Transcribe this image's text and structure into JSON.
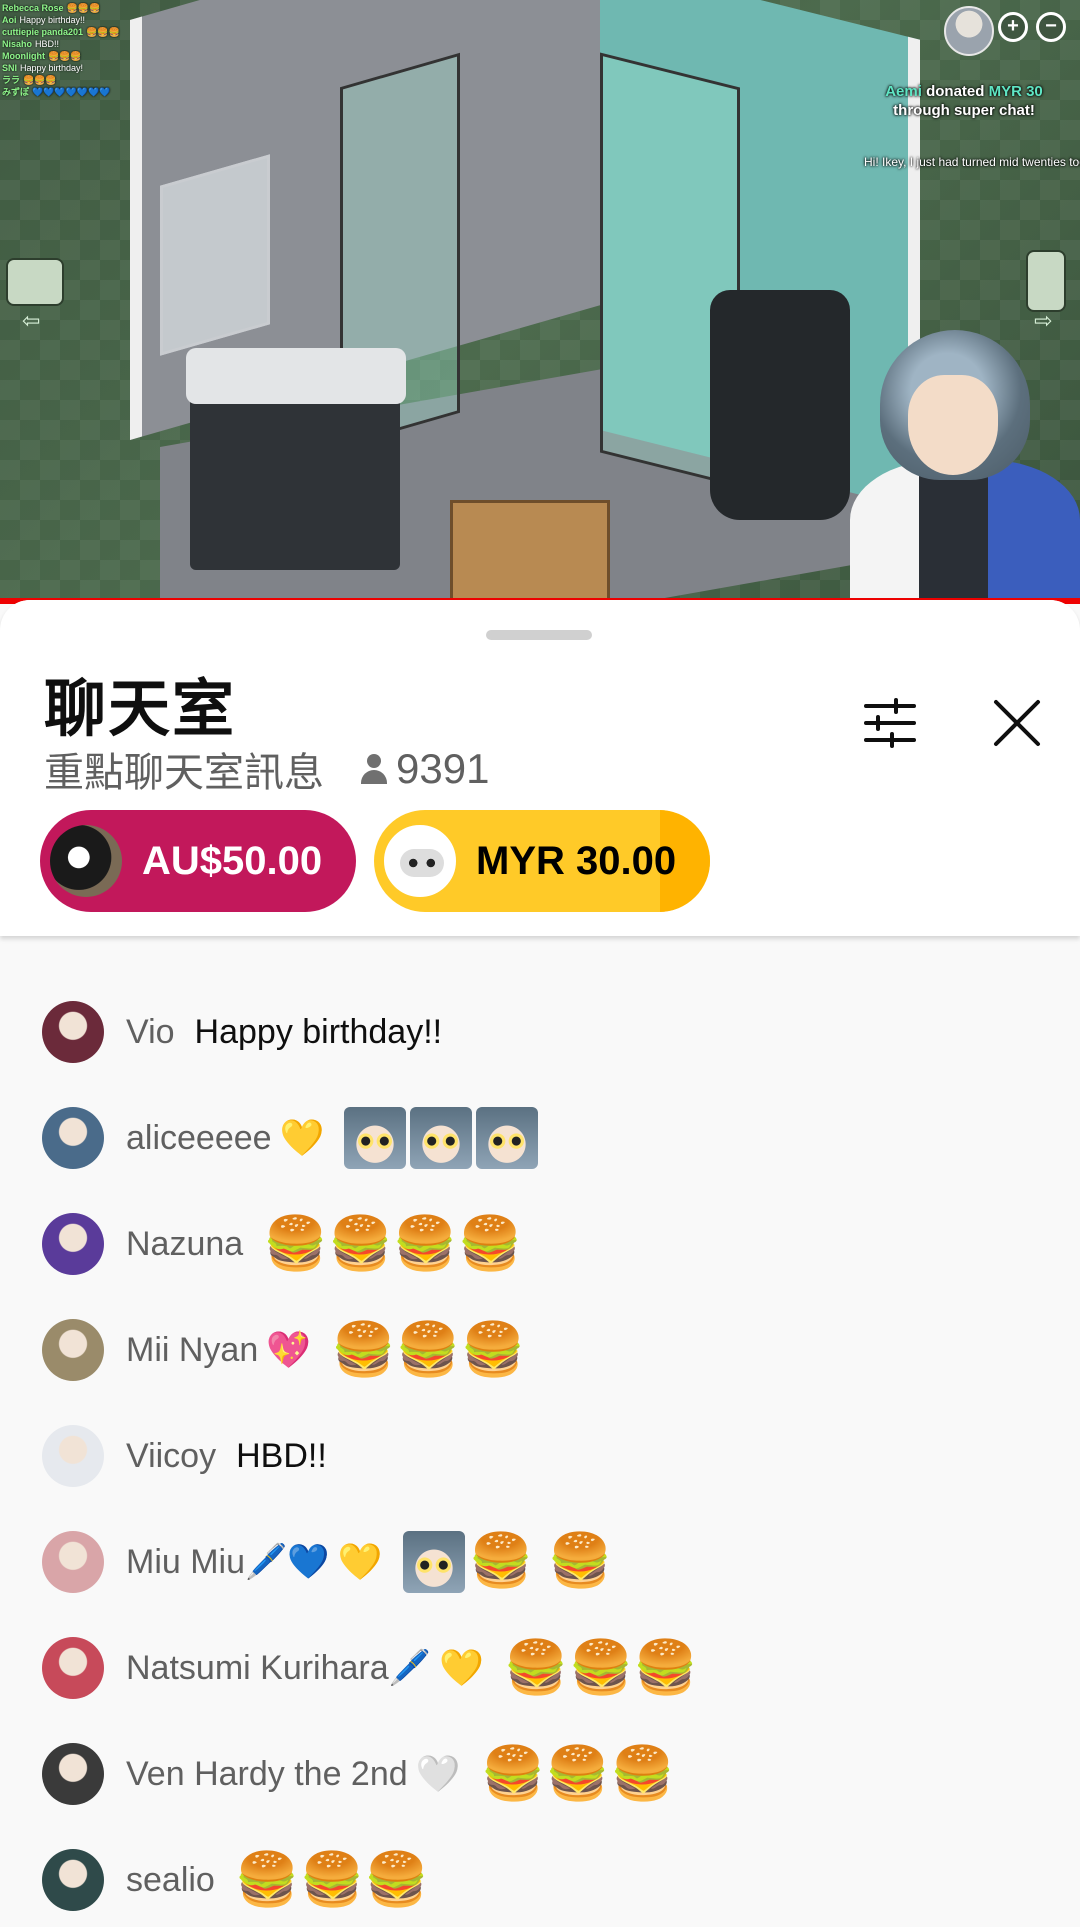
{
  "video": {
    "chat_overlay": [
      {
        "user": "Rebecca Rose",
        "text": "🍔🍔🍔"
      },
      {
        "user": "Aoi",
        "text": "Happy birthday!!"
      },
      {
        "user": "cuttiepie panda201",
        "text": "🍔🍔🍔"
      },
      {
        "user": "Nisaho",
        "text": "HBD!!"
      },
      {
        "user": "Moonlight",
        "text": "🍔🍔🍔"
      },
      {
        "user": "SNI",
        "text": "Happy birthday!"
      },
      {
        "user": "ララ",
        "text": "🍔🍔🍔"
      },
      {
        "user": "みずぽ",
        "text": "💙💙💙💙💙💙💙"
      }
    ],
    "donation": {
      "name": "Aemi",
      "verb": "donated",
      "amount": "MYR 30",
      "through": "through super chat!",
      "message": "Hi! Ikey, I just had turned mid twenties today. Could I get a birthday wish from you? Also, I'm happy you're having fun with this game! mwah :_heart:"
    },
    "zoom_in_label": "+",
    "zoom_out_label": "−",
    "left_arrow": "⇦",
    "right_arrow": "⇨"
  },
  "chat": {
    "title": "聊天室",
    "mode": "重點聊天室訊息",
    "viewer_count": "9391",
    "pinned": [
      {
        "amount": "AU$50.00",
        "color": "#c2185b"
      },
      {
        "amount": "MYR 30.00",
        "color": "#ffca28"
      }
    ],
    "messages": [
      {
        "author": "Vio",
        "badge": "",
        "text": "Happy birthday!!",
        "emotes": "",
        "faces": 0,
        "avatar": "#6b2a3a"
      },
      {
        "author": "aliceeeee",
        "badge": "💛",
        "text": "",
        "emotes": "",
        "faces": 3,
        "avatar": "#4a6b8a"
      },
      {
        "author": "Nazuna",
        "badge": "",
        "text": "",
        "emotes": "🍔🍔🍔🍔",
        "faces": 0,
        "avatar": "#5a3b9a"
      },
      {
        "author": "Mii Nyan",
        "badge": "💖",
        "text": "",
        "emotes": "🍔🍔🍔",
        "faces": 0,
        "avatar": "#9a8b6a"
      },
      {
        "author": "Viicoy",
        "badge": "",
        "text": "HBD!!",
        "emotes": "",
        "faces": 0,
        "avatar": "#e6e9ee"
      },
      {
        "author": "Miu Miu🖊️💙",
        "badge": "💛",
        "text": "",
        "emotes": "🍔 🍔",
        "faces": 1,
        "avatar": "#d9a5a8"
      },
      {
        "author": "Natsumi Kurihara🖊️",
        "badge": "💛",
        "text": "",
        "emotes": "🍔🍔🍔",
        "faces": 0,
        "avatar": "#c74a5a"
      },
      {
        "author": "Ven Hardy the 2nd",
        "badge": "🤍",
        "text": "",
        "emotes": "🍔🍔🍔",
        "faces": 0,
        "avatar": "#3a3a3a"
      },
      {
        "author": "sealio",
        "badge": "",
        "text": "",
        "emotes": "🍔🍔🍔",
        "faces": 0,
        "avatar": "#2f4a4a"
      }
    ]
  }
}
